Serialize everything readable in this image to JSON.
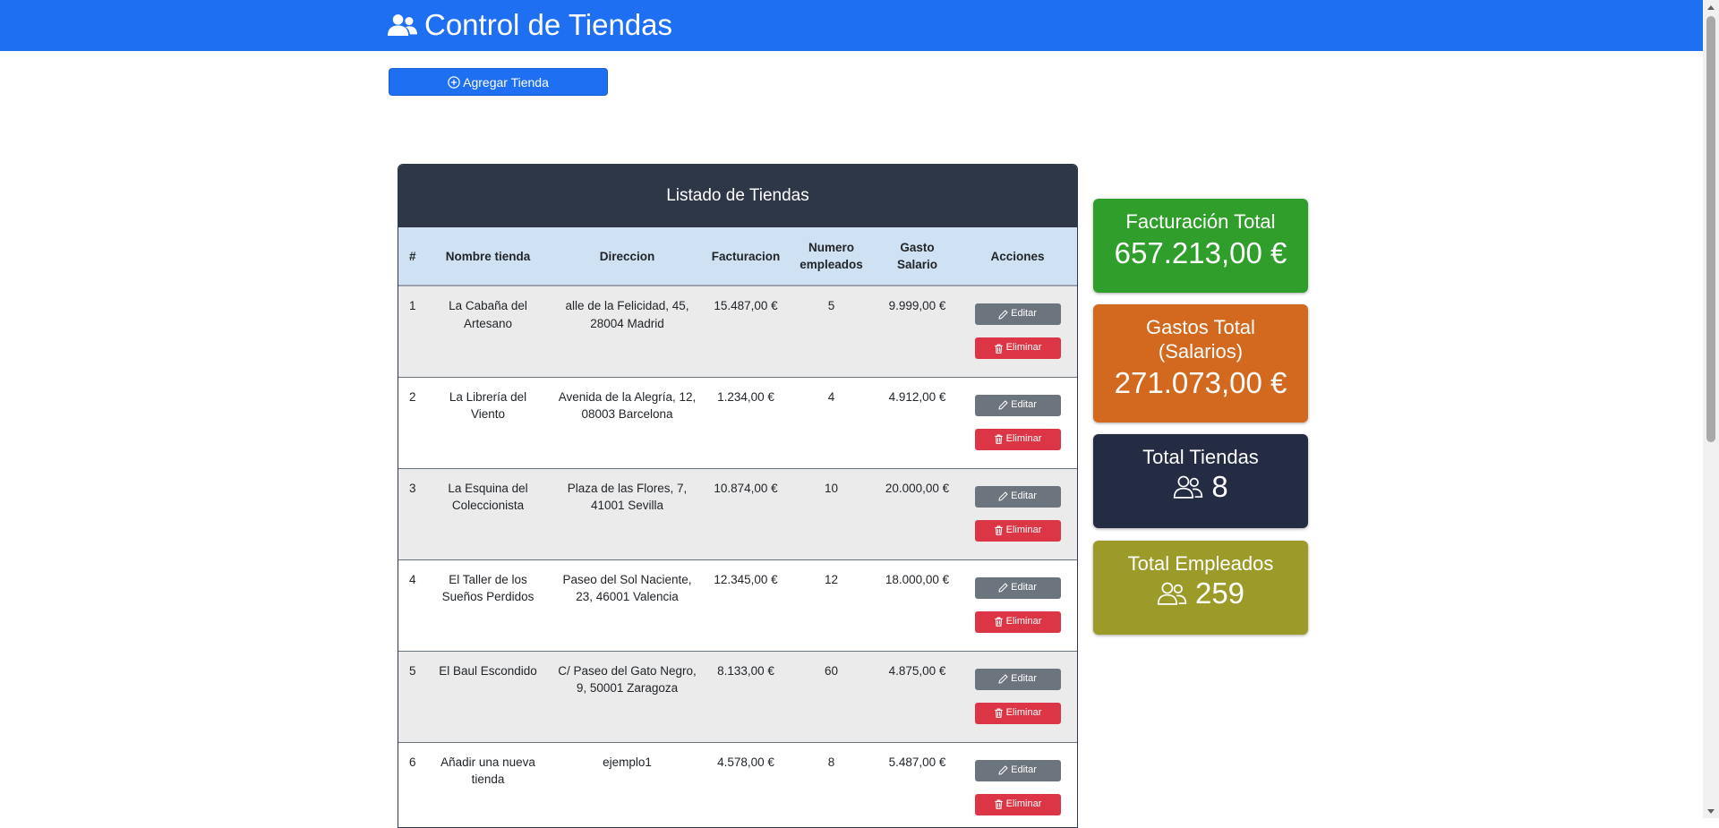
{
  "app": {
    "title": "Control de Tiendas"
  },
  "toolbar": {
    "add_label": "Agregar Tienda"
  },
  "table": {
    "title": "Listado de Tiendas",
    "headers": {
      "index": "#",
      "name": "Nombre tienda",
      "address": "Direccion",
      "revenue": "Facturacion",
      "employees": "Numero empleados",
      "salary": "Gasto Salario",
      "actions": "Acciones"
    },
    "edit_label": "Editar",
    "delete_label": "Eliminar",
    "rows": [
      {
        "id": "1",
        "name": "La Cabaña del Artesano",
        "address": "alle de la Felicidad, 45, 28004 Madrid",
        "revenue": "15.487,00 €",
        "employees": "5",
        "salary": "9.999,00 €"
      },
      {
        "id": "2",
        "name": "La Librería del Viento",
        "address": "Avenida de la Alegría, 12, 08003 Barcelona",
        "revenue": "1.234,00 €",
        "employees": "4",
        "salary": "4.912,00 €"
      },
      {
        "id": "3",
        "name": "La Esquina del Coleccionista",
        "address": "Plaza de las Flores, 7, 41001 Sevilla",
        "revenue": "10.874,00 €",
        "employees": "10",
        "salary": "20.000,00 €"
      },
      {
        "id": "4",
        "name": "El Taller de los Sueños Perdidos",
        "address": "Paseo del Sol Naciente, 23, 46001 Valencia",
        "revenue": "12.345,00 €",
        "employees": "12",
        "salary": "18.000,00 €"
      },
      {
        "id": "5",
        "name": "El Baul Escondido",
        "address": "C/ Paseo del Gato Negro, 9, 50001 Zaragoza",
        "revenue": "8.133,00 €",
        "employees": "60",
        "salary": "4.875,00 €"
      },
      {
        "id": "6",
        "name": "Añadir una nueva tienda",
        "address": "ejemplo1",
        "revenue": "4.578,00 €",
        "employees": "8",
        "salary": "5.487,00 €"
      }
    ]
  },
  "stats": {
    "revenue": {
      "title": "Facturación Total",
      "value": "657.213,00 €",
      "color": "#2f9e2a"
    },
    "expenses": {
      "title": "Gastos Total (Salarios)",
      "value": "271.073,00 €",
      "color": "#d2691e"
    },
    "stores": {
      "title": "Total Tiendas",
      "value": "8",
      "icon": "people-icon",
      "color": "#242c44"
    },
    "employees": {
      "title": "Total Empleados",
      "value": "259",
      "icon": "people-icon",
      "color": "#9c9a29"
    }
  },
  "colors": {
    "navbar": "#1f6ff2",
    "table_header": "#2d3748",
    "edit": "#6c757d",
    "delete": "#dc3545"
  }
}
